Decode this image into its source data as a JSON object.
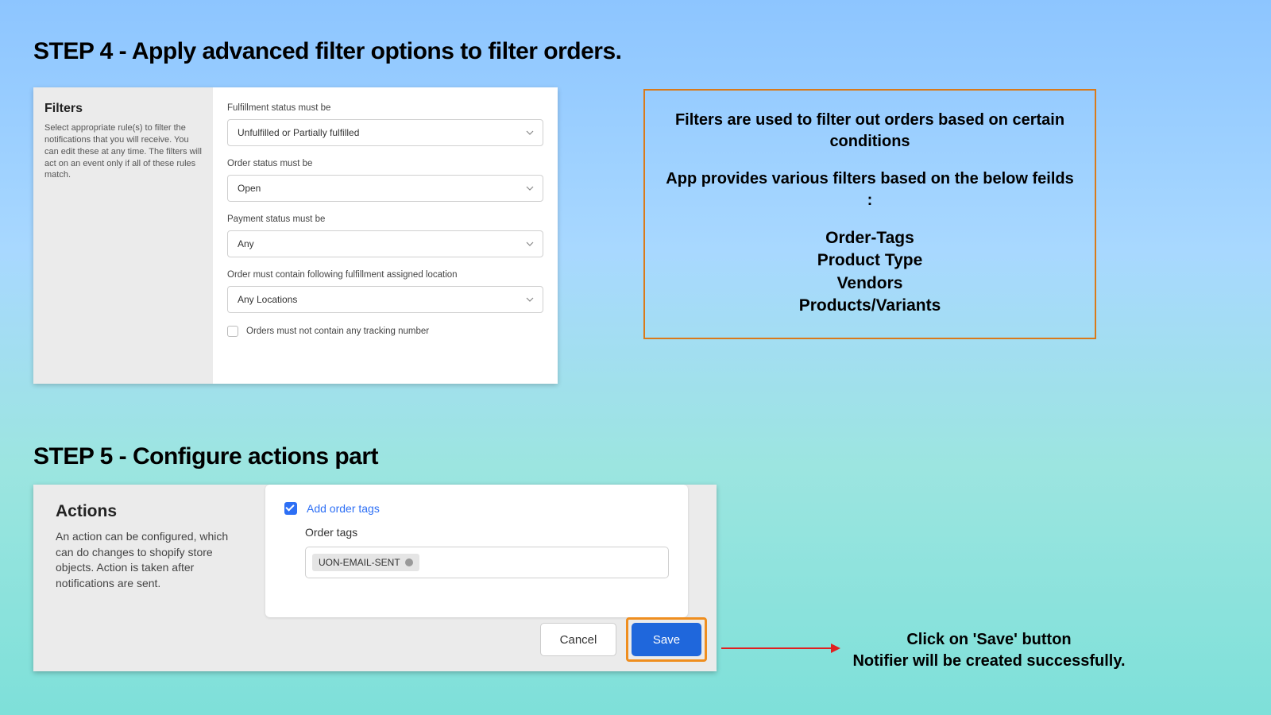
{
  "step4": {
    "heading": "STEP 4 - Apply advanced filter options to filter orders.",
    "filters": {
      "title": "Filters",
      "description": "Select appropriate rule(s) to filter the notifications that you will receive. You can edit these at any time. The filters will act on an event only if all of these rules match.",
      "fields": {
        "fulfillment": {
          "label": "Fulfillment status must be",
          "value": "Unfulfilled or Partially fulfilled"
        },
        "order_status": {
          "label": "Order status must be",
          "value": "Open"
        },
        "payment": {
          "label": "Payment status must be",
          "value": "Any"
        },
        "location": {
          "label": "Order must contain following fulfillment assigned location",
          "value": "Any Locations"
        },
        "tracking_checkbox": "Orders must not contain any tracking number"
      }
    }
  },
  "info": {
    "line1": "Filters are used to filter out orders based on certain conditions",
    "line2": "App provides various filters based on the below feilds :",
    "items": [
      "Order-Tags",
      "Product Type",
      "Vendors",
      "Products/Variants"
    ]
  },
  "step5": {
    "heading": "STEP 5 - Configure actions part",
    "actions": {
      "title": "Actions",
      "description": "An action can be configured, which can do changes to shopify store objects. Action is taken after notifications are sent.",
      "add_order_tags_label": "Add order tags",
      "order_tags_label": "Order tags",
      "tag_value": "UON-EMAIL-SENT"
    },
    "buttons": {
      "cancel": "Cancel",
      "save": "Save"
    }
  },
  "save_callout": {
    "line1": "Click on 'Save' button",
    "line2": "Notifier will be created successfully."
  }
}
